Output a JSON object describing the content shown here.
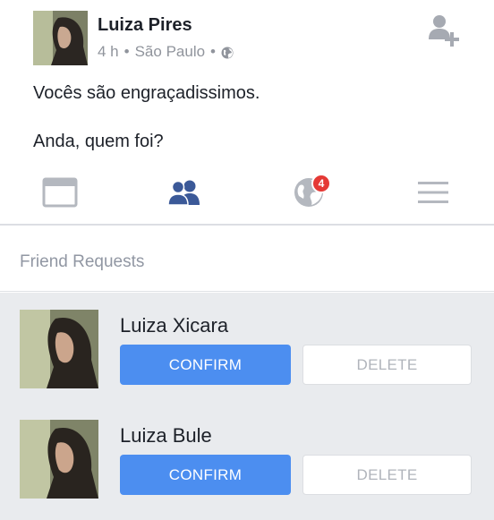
{
  "post": {
    "author": "Luiza Pires",
    "time": "4 h",
    "separator": "•",
    "location": "São Paulo",
    "separator2": "•",
    "privacy_icon": "globe-icon",
    "lines": [
      "Vocês são engraçadissimos.",
      "Anda, quem foi?"
    ],
    "action_icon": "add-friend-icon"
  },
  "tabs": [
    {
      "icon": "news-feed-icon"
    },
    {
      "icon": "friends-icon",
      "active": true
    },
    {
      "icon": "notifications-globe-icon",
      "badge": "4"
    },
    {
      "icon": "menu-icon"
    }
  ],
  "friend_requests": {
    "title": "Friend Requests",
    "requests": [
      {
        "name": "Luiza Xicara",
        "confirm_label": "CONFIRM",
        "delete_label": "DELETE"
      },
      {
        "name": "Luiza Bule",
        "confirm_label": "CONFIRM",
        "delete_label": "DELETE"
      }
    ]
  },
  "colors": {
    "accent": "#3b5998",
    "confirm_bg": "#4c8ef0",
    "badge": "#e53935",
    "list_bg": "#e9ebee"
  }
}
